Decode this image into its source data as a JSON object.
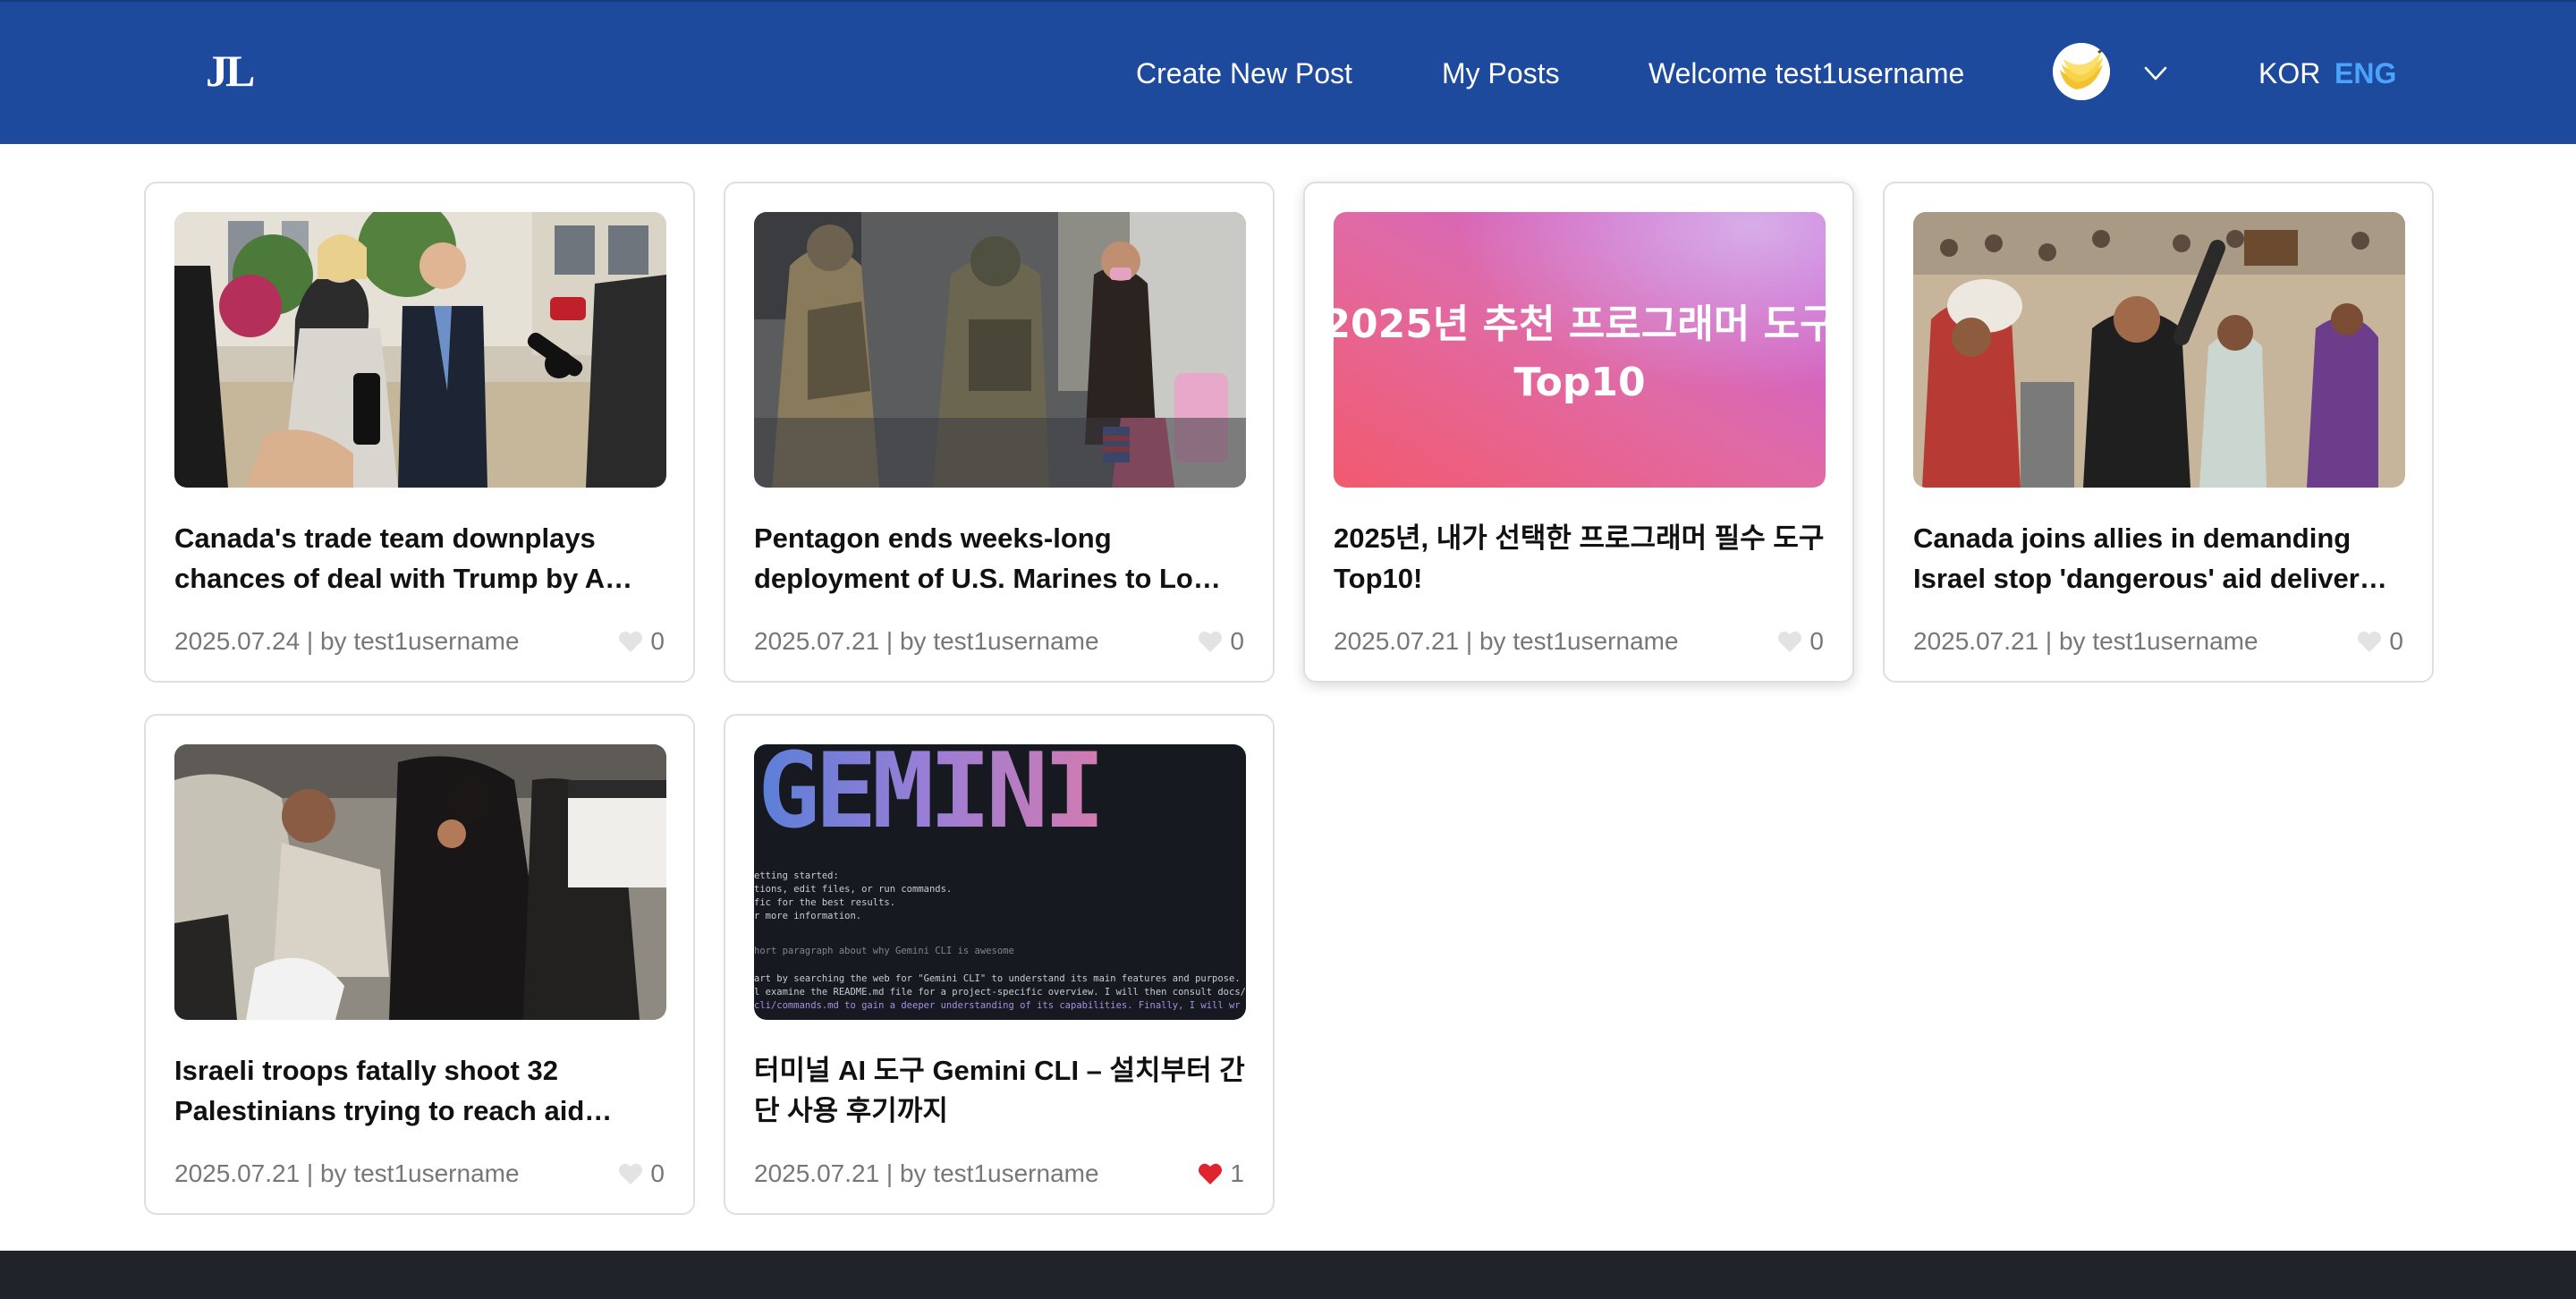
{
  "header": {
    "logo": "JL",
    "nav": {
      "create_post": "Create New Post",
      "my_posts": "My Posts",
      "welcome": "Welcome test1username"
    },
    "avatar_icon": "banana-avatar",
    "lang": {
      "kor": "KOR",
      "eng": "ENG"
    },
    "colors": {
      "bar": "#1d4a9c",
      "active_lang": "#4aa3ff"
    }
  },
  "posts": [
    {
      "title": "Canada's trade team downplays chances of deal with Trump by A…",
      "meta": "2025.07.24 | by test1username",
      "likes": "0",
      "liked": false,
      "thumbnail": "press-conference-photo"
    },
    {
      "title": "Pentagon ends weeks-long deployment of U.S. Marines to Lo…",
      "meta": "2025.07.21 | by test1username",
      "likes": "0",
      "liked": false,
      "thumbnail": "marines-street-photo"
    },
    {
      "title": "2025년, 내가 선택한 프로그래머 필수 도구 Top10!",
      "meta": "2025.07.21 | by test1username",
      "likes": "0",
      "liked": false,
      "thumbnail": "gradient-banner",
      "banner_text": {
        "line1": "2025년 추천 프로그래머 도구",
        "line2": "Top10"
      }
    },
    {
      "title": "Canada joins allies in demanding Israel stop 'dangerous' aid deliver…",
      "meta": "2025.07.21 | by test1username",
      "likes": "0",
      "liked": false,
      "thumbnail": "aid-crowd-photo"
    },
    {
      "title": "Israeli troops fatally shoot 32 Palestinians trying to reach aid…",
      "meta": "2025.07.21 | by test1username",
      "likes": "0",
      "liked": false,
      "thumbnail": "mourners-photo"
    },
    {
      "title": "터미널 AI 도구 Gemini CLI – 설치부터 간단 사용 후기까지",
      "meta": "2025.07.21 | by test1username",
      "likes": "1",
      "liked": true,
      "thumbnail": "terminal-screenshot",
      "terminal_text": {
        "banner": "GEMINI",
        "lines": [
          "etting started:",
          "tions, edit files, or run commands.",
          "fic for the best results.",
          "r more information.",
          "hort paragraph about why Gemini CLI is awesome",
          "art by searching the web for \"Gemini CLI\" to understand its main features and purpose.",
          "l examine the README.md file for a project-specific overview. I will then consult docs/",
          "cli/commands.md to gain a deeper understanding of its capabilities. Finally, I will wr"
        ]
      }
    }
  ],
  "heart_colors": {
    "empty": "#e3e3e3",
    "liked": "#e0242d"
  }
}
